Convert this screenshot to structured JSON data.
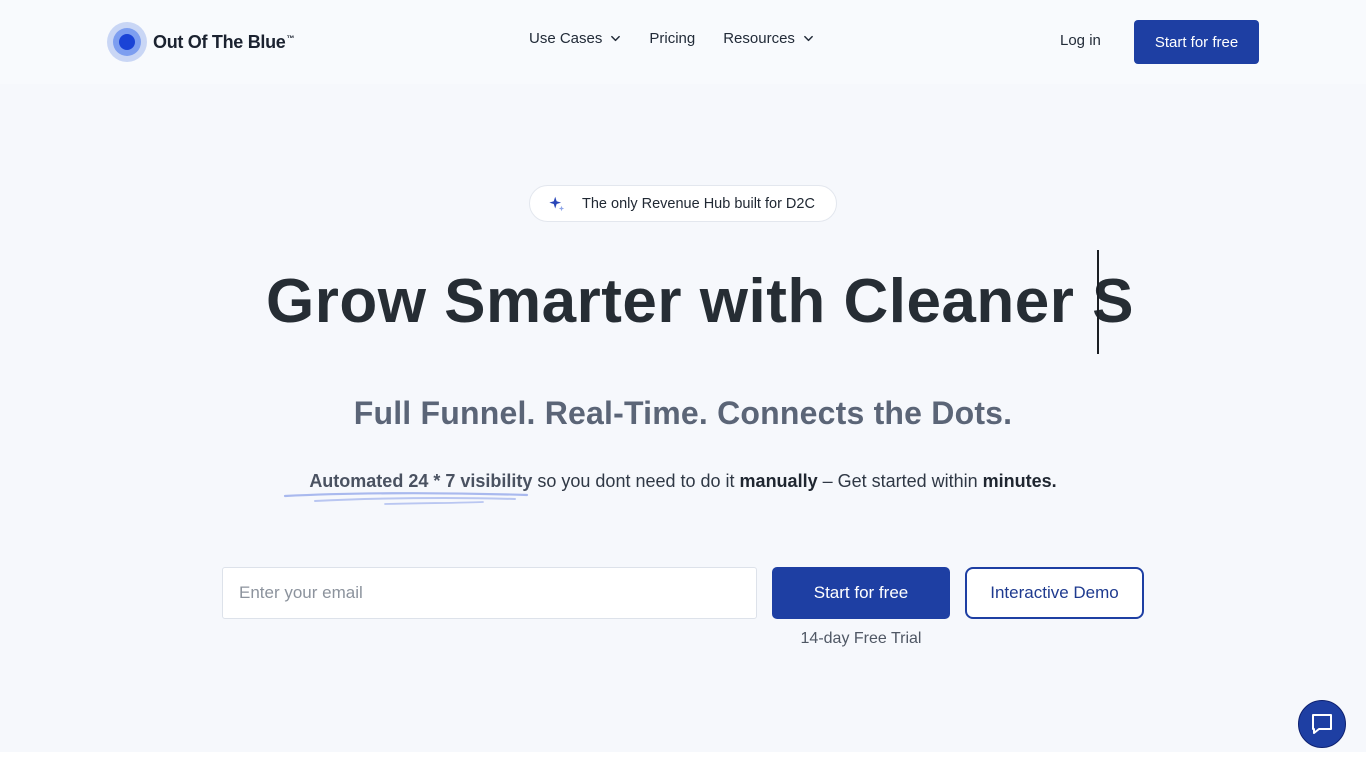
{
  "brand": {
    "name": "Out Of The Blue",
    "tm": "™",
    "colors": {
      "primary": "#1e3fa3",
      "logo_core": "#1a43d6"
    }
  },
  "nav": {
    "items": [
      {
        "label": "Use Cases",
        "has_dropdown": true
      },
      {
        "label": "Pricing",
        "has_dropdown": false
      },
      {
        "label": "Resources",
        "has_dropdown": true
      }
    ],
    "login_label": "Log in",
    "cta_label": "Start for free"
  },
  "hero": {
    "badge": {
      "icon": "sparkle-icon",
      "text": "The only Revenue Hub built for D2C"
    },
    "headline": "Grow Smarter with Cleaner S",
    "subheadline": "Full Funnel. Real-Time. Connects the Dots.",
    "tagline": {
      "highlight": "Automated 24 * 7 visibility",
      "part1": " so you dont need to do it ",
      "bold1": "manually",
      "part2": " – Get started within ",
      "bold2": "minutes."
    }
  },
  "form": {
    "email_placeholder": "Enter your email",
    "email_value": "",
    "start_label": "Start for free",
    "demo_label": "Interactive Demo",
    "trial_note": "14-day Free Trial"
  },
  "chat": {
    "icon": "chat-bubble-icon"
  }
}
